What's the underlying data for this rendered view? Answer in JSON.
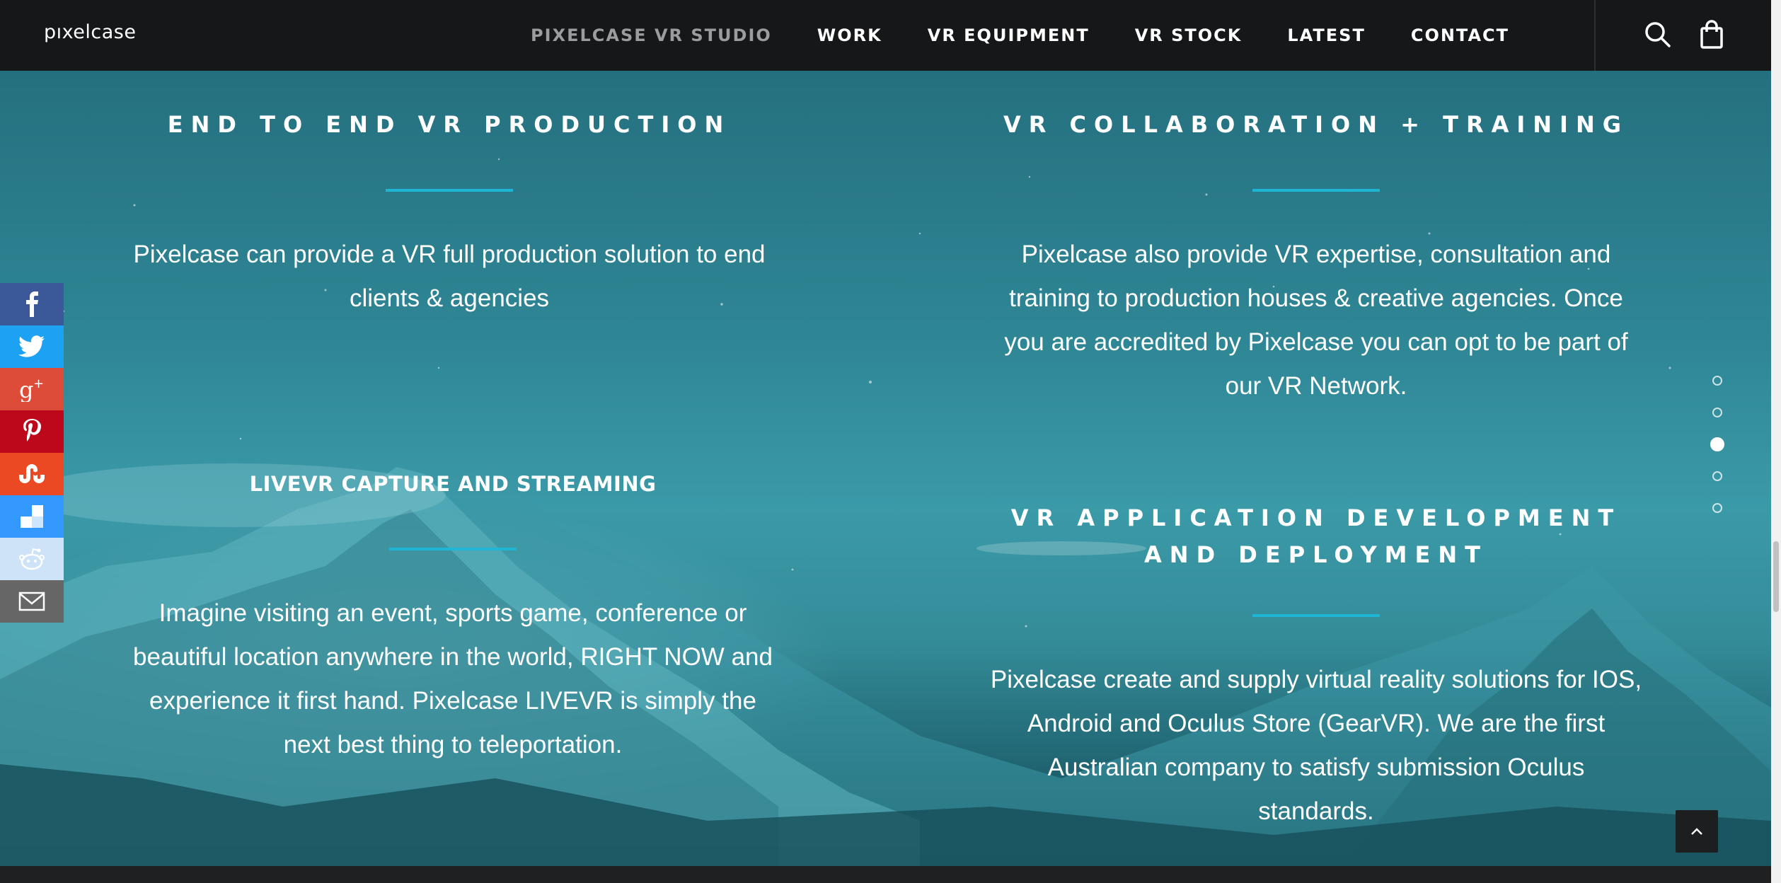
{
  "header": {
    "logo": "pıxelcase",
    "nav": [
      {
        "label": "PIXELCASE VR STUDIO",
        "active": true
      },
      {
        "label": "WORK"
      },
      {
        "label": "VR EQUIPMENT"
      },
      {
        "label": "VR STOCK"
      },
      {
        "label": "LATEST"
      },
      {
        "label": "CONTACT"
      }
    ],
    "icons": [
      "search-icon",
      "shopping-bag-icon"
    ]
  },
  "sections": {
    "end_to_end": {
      "title": "END TO END VR PRODUCTION",
      "text": "Pixelcase can provide a VR full production solution to end clients & agencies"
    },
    "collaboration": {
      "title": "VR COLLABORATION + TRAINING",
      "text": "Pixelcase also provide VR expertise, consultation and training to production houses & creative agencies. Once you are accredited by Pixelcase you can opt to be part of our VR Network."
    },
    "livevr": {
      "title": "LIVEVR CAPTURE AND STREAMING",
      "text": "Imagine visiting an event, sports game, conference or beautiful location anywhere in the world, RIGHT NOW and experience it first hand. Pixelcase LIVEVR is simply the next best thing to teleportation."
    },
    "app_dev": {
      "title": "VR APPLICATION DEVELOPMENT AND DEPLOYMENT",
      "text": "Pixelcase create and supply virtual reality solutions for IOS, Android and Oculus Store (GearVR). We are the first Australian company to satisfy submission Oculus standards."
    }
  },
  "social": [
    {
      "name": "facebook",
      "color": "#3b5998"
    },
    {
      "name": "twitter",
      "color": "#1da1f2"
    },
    {
      "name": "google-plus",
      "color": "#dd4b39"
    },
    {
      "name": "pinterest",
      "color": "#bd081c"
    },
    {
      "name": "stumbleupon",
      "color": "#eb4924"
    },
    {
      "name": "delicious",
      "color": "#3399ff"
    },
    {
      "name": "reddit",
      "color": "#cee3f8"
    },
    {
      "name": "email",
      "color": "#666666"
    }
  ],
  "page_dots": {
    "count": 5,
    "active_index": 2
  },
  "colors": {
    "accent": "#1fb6d6",
    "header_bg": "#151719"
  }
}
